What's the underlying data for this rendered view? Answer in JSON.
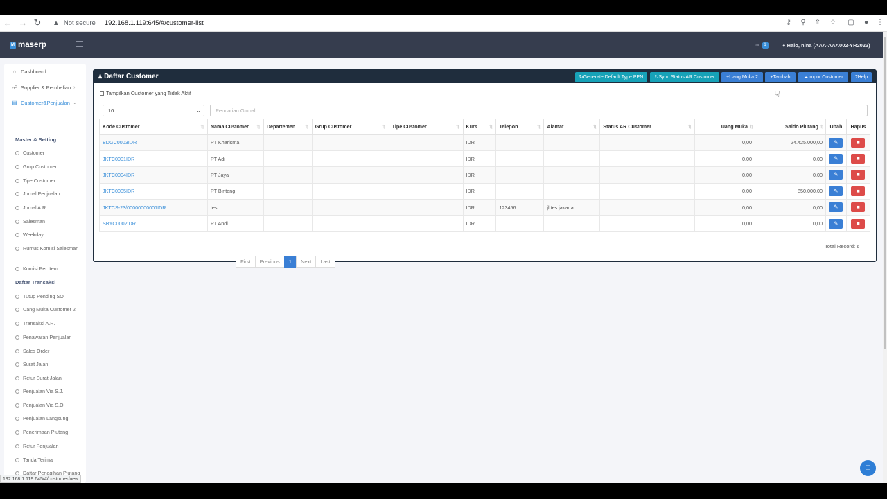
{
  "browser": {
    "security": "Not secure",
    "url": "192.168.1.119:645/#/customer-list",
    "status_url": "192.168.1.119:645/#/customer/new"
  },
  "header": {
    "logo": "maserp",
    "logo_mark": "M",
    "notif_count": "1",
    "user_greeting": "Halo, nina (AAA-AAA002-YR2023)"
  },
  "sidebar": {
    "items": [
      {
        "label": "Dashboard",
        "icon": "home-icon"
      },
      {
        "label": "Supplier & Pembelian",
        "icon": "cart-icon"
      },
      {
        "label": "Customer&Penjualan",
        "icon": "card-icon"
      }
    ],
    "section_master": "Master & Setting",
    "master": [
      "Customer",
      "Grup Customer",
      "Tipe Customer",
      "Jurnal Penjualan",
      "Jurnal A.R.",
      "Salesman",
      "Weekday",
      "Rumus Komisi Salesman",
      "Komisi Per Item"
    ],
    "section_trans": "Daftar Transaksi",
    "trans": [
      "Tutup Pending SO",
      "Uang Muka Customer 2",
      "Transaksi A.R.",
      "Penawaran Penjualan",
      "Sales Order",
      "Surat Jalan",
      "Retur Surat Jalan",
      "Penjualan Via S.J.",
      "Penjualan Via S.O.",
      "Penjualan Langsung",
      "Penerimaan Piutang",
      "Retur Penjualan",
      "Tanda Terima",
      "Daftar Penagihan Piutang"
    ]
  },
  "panel": {
    "title": "Daftar Customer",
    "buttons": [
      {
        "label": "Generate Default Type PPN",
        "icon": "refresh-icon"
      },
      {
        "label": "Sync Status AR Customer",
        "icon": "refresh-icon"
      },
      {
        "label": "Uang Muka 2",
        "icon": "plus-icon"
      },
      {
        "label": "Tambah",
        "icon": "plus-icon"
      },
      {
        "label": "Impor Customer",
        "icon": "cloud-upload-icon"
      },
      {
        "label": "Help",
        "icon": "question-icon"
      }
    ],
    "inactive_label": "Tampilkan Customer yang Tidak Aktif",
    "page_size": "10",
    "search_placeholder": "Pencarian Global"
  },
  "table": {
    "headers": [
      "Kode Customer",
      "Nama Customer",
      "Departemen",
      "Grup Customer",
      "Tipe Customer",
      "Kurs",
      "Telepon",
      "Alamat",
      "Status AR Customer",
      "Uang Muka",
      "Saldo Piutang",
      "Ubah",
      "Hapus"
    ],
    "rows": [
      {
        "kode": "BDGC0003IDR",
        "nama": "PT Kharisma",
        "dept": "",
        "grup": "",
        "tipe": "",
        "kurs": "IDR",
        "telp": "",
        "alamat": "",
        "status": "",
        "uang_muka": "0,00",
        "saldo": "24.425.000,00"
      },
      {
        "kode": "JKTC0001IDR",
        "nama": "PT Adi",
        "dept": "",
        "grup": "",
        "tipe": "",
        "kurs": "IDR",
        "telp": "",
        "alamat": "",
        "status": "",
        "uang_muka": "0,00",
        "saldo": "0,00"
      },
      {
        "kode": "JKTC0004IDR",
        "nama": "PT Jaya",
        "dept": "",
        "grup": "",
        "tipe": "",
        "kurs": "IDR",
        "telp": "",
        "alamat": "",
        "status": "",
        "uang_muka": "0,00",
        "saldo": "0,00"
      },
      {
        "kode": "JKTC0005IDR",
        "nama": "PT Bintang",
        "dept": "",
        "grup": "",
        "tipe": "",
        "kurs": "IDR",
        "telp": "",
        "alamat": "",
        "status": "",
        "uang_muka": "0,00",
        "saldo": "850.000,00"
      },
      {
        "kode": "JKTCS-23/00000000001IDR",
        "nama": "tes",
        "dept": "",
        "grup": "",
        "tipe": "",
        "kurs": "IDR",
        "telp": "123456",
        "alamat": "jl tes jakarta",
        "status": "",
        "uang_muka": "0,00",
        "saldo": "0,00"
      },
      {
        "kode": "SBYC0002IDR",
        "nama": "PT Andi",
        "dept": "",
        "grup": "",
        "tipe": "",
        "kurs": "IDR",
        "telp": "",
        "alamat": "",
        "status": "",
        "uang_muka": "0,00",
        "saldo": "0,00"
      }
    ]
  },
  "pager": {
    "first": "First",
    "previous": "Previous",
    "current": "1",
    "next": "Next",
    "last": "Last"
  },
  "total_record": "Total Record: 6",
  "colors": {
    "header": "#363d4e",
    "panel_head": "#1f2d3d",
    "teal": "#17a2b8",
    "blue": "#3a7fd5",
    "red": "#dd4b49",
    "link": "#3a8fd9"
  }
}
